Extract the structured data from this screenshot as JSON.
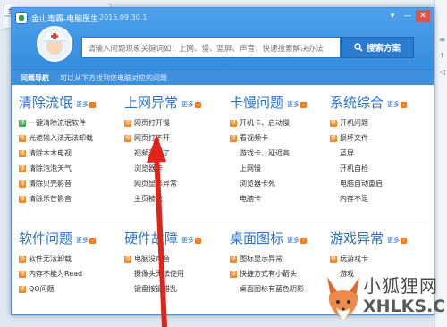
{
  "browser": {
    "tab1": "金山毒霸_百度经验",
    "tab2": "",
    "right_glyphs": [
      "≡",
      "↑",
      "◁",
      "✦",
      "▣"
    ]
  },
  "dialog": {
    "app_title": "金山毒霸-电脑医生",
    "app_date": "2015.09.30.1",
    "window_buttons": {
      "menu": "▾",
      "minimize": "—",
      "close": "✕"
    },
    "search": {
      "placeholder": "请输入问题现象关键词如：上网、慢、蓝屏、声音；快速搜索解决办法",
      "button_label": "搜索方案",
      "button_icon": "search-icon"
    },
    "nav": {
      "title": "问题导航",
      "subtitle": "可以从下方找到您电脑对应的问题"
    }
  },
  "more_label": "更多",
  "categories": [
    {
      "title": "清除流氓",
      "items": [
        {
          "label": "一键清除流氓软件",
          "badge": "green"
        },
        {
          "label": "光速输入法无法卸载",
          "badge": "orange"
        },
        {
          "label": "清除木木电视",
          "badge": "orange"
        },
        {
          "label": "清除泡泡天气",
          "badge": "orange"
        },
        {
          "label": "清除贝壳影音",
          "badge": "orange"
        },
        {
          "label": "清除乐芒影音",
          "badge": "orange"
        }
      ]
    },
    {
      "title": "上网异常",
      "items": [
        {
          "label": "网页打开慢",
          "badge": "orange"
        },
        {
          "label": "网页打不开",
          "badge": "orange"
        },
        {
          "label": "视频看不了",
          "badge": "none"
        },
        {
          "label": "浏览器卡",
          "badge": "none"
        },
        {
          "label": "网页显示异常",
          "badge": "none"
        },
        {
          "label": "主页被改",
          "badge": "none"
        }
      ]
    },
    {
      "title": "卡慢问题",
      "items": [
        {
          "label": "开机卡、启动慢",
          "badge": "orange"
        },
        {
          "label": "看视频卡",
          "badge": "orange"
        },
        {
          "label": "游戏卡、延迟高",
          "badge": "none"
        },
        {
          "label": "上网慢",
          "badge": "none"
        },
        {
          "label": "浏览器卡死",
          "badge": "none"
        },
        {
          "label": "电脑卡",
          "badge": "none"
        }
      ]
    },
    {
      "title": "系统综合",
      "items": [
        {
          "label": "开机问题",
          "badge": "orange"
        },
        {
          "label": "损坏文件",
          "badge": "orange"
        },
        {
          "label": "蓝屏",
          "badge": "none"
        },
        {
          "label": "开机自检",
          "badge": "none"
        },
        {
          "label": "电脑自动重启",
          "badge": "none"
        },
        {
          "label": "内存不足",
          "badge": "none"
        }
      ]
    },
    {
      "title": "软件问题",
      "items": [
        {
          "label": "软件无法卸载",
          "badge": "orange"
        },
        {
          "label": "内存不能为Read",
          "badge": "orange"
        },
        {
          "label": "QQ问题",
          "badge": "orange"
        }
      ]
    },
    {
      "title": "硬件故障",
      "items": [
        {
          "label": "电脑没声音",
          "badge": "orange"
        },
        {
          "label": "摄像头无法使用",
          "badge": "none"
        },
        {
          "label": "键盘按键错乱",
          "badge": "none"
        }
      ]
    },
    {
      "title": "桌面图标",
      "items": [
        {
          "label": "图标显示异常",
          "badge": "orange"
        },
        {
          "label": "快捷方式有小箭头",
          "badge": "orange"
        },
        {
          "label": "桌面图标有蓝色阴影",
          "badge": "none"
        }
      ]
    },
    {
      "title": "游戏异常",
      "items": [
        {
          "label": "玩游戏卡",
          "badge": "orange"
        },
        {
          "label": "游戏",
          "badge": "none"
        },
        {
          "label": "",
          "badge": "none"
        }
      ]
    }
  ],
  "watermark": {
    "title": "小狐狸网",
    "url": "XHLKS.CN"
  },
  "colors": {
    "accent_blue": "#2b74c4",
    "header_blue": "#3e8fde",
    "badge_orange": "#ef8a2a",
    "badge_green": "#3eaa48",
    "arrow_red": "#e0231b"
  }
}
